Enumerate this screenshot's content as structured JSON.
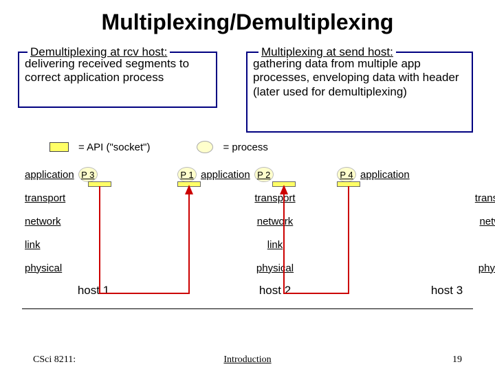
{
  "title": "Multiplexing/Demultiplexing",
  "demux": {
    "legend": "Demultiplexing at rcv host:",
    "body": "delivering received segments to correct application process"
  },
  "mux": {
    "legend": "Multiplexing at send host:",
    "body": "gathering data from multiple app processes, enveloping data with header (later used for demultiplexing)"
  },
  "legend_api": "= API (\"socket\")",
  "legend_proc": "= process",
  "layers": {
    "application": "application",
    "transport": "transport",
    "network": "network",
    "link": "link",
    "physical": "physical"
  },
  "procs": {
    "p1": "P 1",
    "p2": "P 2",
    "p3": "P 3",
    "p4": "P 4"
  },
  "hosts": {
    "h1": "host 1",
    "h2": "host 2",
    "h3": "host 3"
  },
  "footer": {
    "left": "CSci 8211:",
    "mid": "Introduction",
    "right": "19"
  }
}
